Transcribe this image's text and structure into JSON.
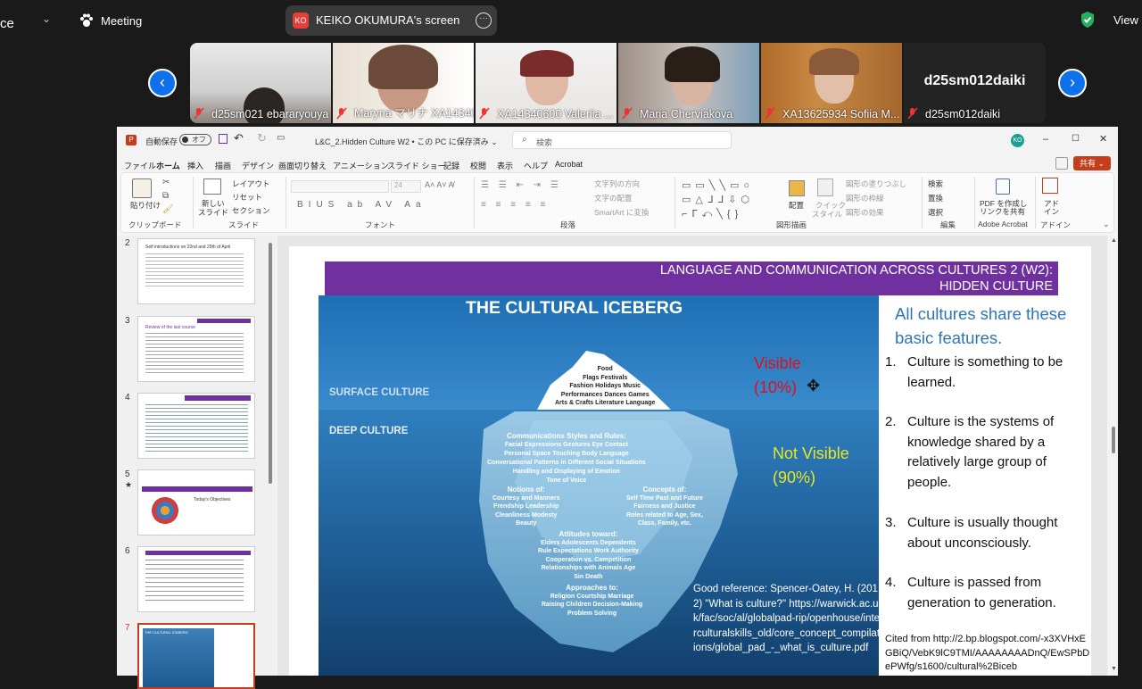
{
  "zoom_topbar": {
    "app_fragment": "ce",
    "meeting_label": "Meeting",
    "screen_label": "KEIKO OKUMURA's screen",
    "screen_badge": "KO",
    "view_label": "View"
  },
  "gallery": {
    "tiles": [
      {
        "name": "d25sm021 ebararyouya"
      },
      {
        "name": "Maryna マリナ XA14340..."
      },
      {
        "name": "XA14340600 Valeriia ..."
      },
      {
        "name": "Maria Cherviakova"
      },
      {
        "name": "XA13625934 Sofiia M..."
      },
      {
        "name": "d25sm012daiki",
        "big_name": "d25sm012daiki"
      }
    ]
  },
  "ppt": {
    "autosave_label": "自動保存",
    "autosave_state": "オフ",
    "doc_title": "L&C_2.Hidden Culture W2 • この PC に保存済み ⌄",
    "search_placeholder": "検索",
    "user_initials": "KO",
    "share_label": "共有",
    "menu": [
      "ファイル",
      "ホーム",
      "挿入",
      "描画",
      "デザイン",
      "画面切り替え",
      "アニメーション",
      "スライド ショー",
      "記録",
      "校閲",
      "表示",
      "ヘルプ",
      "Acrobat"
    ],
    "ribbon": {
      "paste": "貼り付け",
      "clipboard": "クリップボード",
      "layout": "レイアウト",
      "reset": "リセット",
      "section": "セクション",
      "new_slide": "新しい",
      "new_slide2": "スライド",
      "slides_group": "スライド",
      "font_group": "フォント",
      "font_size": "24",
      "text_direction": "文字列の方向",
      "align_text": "文字の配置",
      "smartart": "SmartArt に変換",
      "paragraph_group": "段落",
      "arrange": "配置",
      "quick_style": "クイック",
      "quick_style2": "スタイル",
      "shape_fill": "図形の塗りつぶし",
      "shape_outline": "図形の枠線",
      "shape_effects": "図形の効果",
      "drawing_group": "図形描画",
      "find": "検索",
      "replace": "置換",
      "select": "選択",
      "editing_group": "編集",
      "pdf_share": "PDF を作成し",
      "pdf_share2": "リンクを共有",
      "acrobat_group": "Adobe Acrobat",
      "addin": "アド",
      "addin2": "イン",
      "addin_group": "アドイン"
    },
    "thumbnails": [
      {
        "num": "2",
        "text": "Self introductions on 22nd and 29th of April"
      },
      {
        "num": "3",
        "text": "Review of the last course"
      },
      {
        "num": "4",
        "text": ""
      },
      {
        "num": "5",
        "text": "Today's Objectives"
      },
      {
        "num": "6",
        "text": ""
      },
      {
        "num": "7",
        "text": "THE CULTURAL ICEBERG"
      }
    ]
  },
  "slide": {
    "banner_line1": "LANGUAGE AND COMMUNICATION ACROSS CULTURES 2 (W2):",
    "banner_line2": "HIDDEN CULTURE",
    "iceberg_title": "THE CULTURAL ICEBERG",
    "surface": "SURFACE CULTURE",
    "deep": "DEEP CULTURE",
    "visible1": "Visible",
    "visible2": "(10%)",
    "notvisible1": "Not Visible",
    "notvisible2": "(90%)",
    "tip": [
      "Food",
      "Flags    Festivals",
      "Fashion  Holidays  Music",
      "Performances  Dances  Games",
      "Arts & Crafts  Literature  Language"
    ],
    "comm_head": "Communications Styles and Rules:",
    "comm": [
      "Facial Expressions     Gestures       Eye Contact",
      "Personal Space    Touching    Body Language",
      "Conversational Patterns in Different Social Situations",
      "Handling and Displaying of Emotion",
      "Tone of Voice"
    ],
    "notions_head": "Notions of:",
    "notions": [
      "Courtesy and Manners",
      "Frendship    Leadership",
      "Cleanliness    Modesty",
      "Beauty"
    ],
    "concepts_head": "Concepts of:",
    "concepts": [
      "Self   Time   Past and Future",
      "Fairness and Justice",
      "Roles related to Age, Sex,",
      "Class, Family, etc."
    ],
    "attitudes_head": "Attitudes toward:",
    "attitudes": [
      "Elders   Adolescents   Dependents",
      "Rule   Expectations   Work   Authority",
      "Cooperation vs. Competition",
      "Relationships with Animals   Age",
      "Sin   Death"
    ],
    "approaches_head": "Approaches to:",
    "approaches": [
      "Religion   Courtship   Marriage",
      "Raising Children   Decision-Making",
      "Problem Solving"
    ],
    "good_ref": "Good reference: Spencer-Oatey, H. (2012)  \"What is culture?\" https://warwick.ac.uk/fac/soc/al/globalpad-rip/openhouse/interculturalskills_old/core_concept_compilations/global_pad_-_what_is_culture.pdf",
    "share_title": "All cultures share these basic features.",
    "points": [
      {
        "n": "1.",
        "t": "Culture is something to be learned."
      },
      {
        "n": "2.",
        "t": "Culture is the systems of knowledge shared by a relatively large group of people."
      },
      {
        "n": "3.",
        "t": "Culture is usually thought  about unconsciously."
      },
      {
        "n": "4.",
        "t": "Culture is passed from generation to generation."
      }
    ],
    "cited": "Cited from http://2.bp.blogspot.com/-x3XVHxEGBiQ/VebK9lC9TMI/AAAAAAAADnQ/EwSPbDePWfg/s1600/cultural%2Biceb"
  }
}
